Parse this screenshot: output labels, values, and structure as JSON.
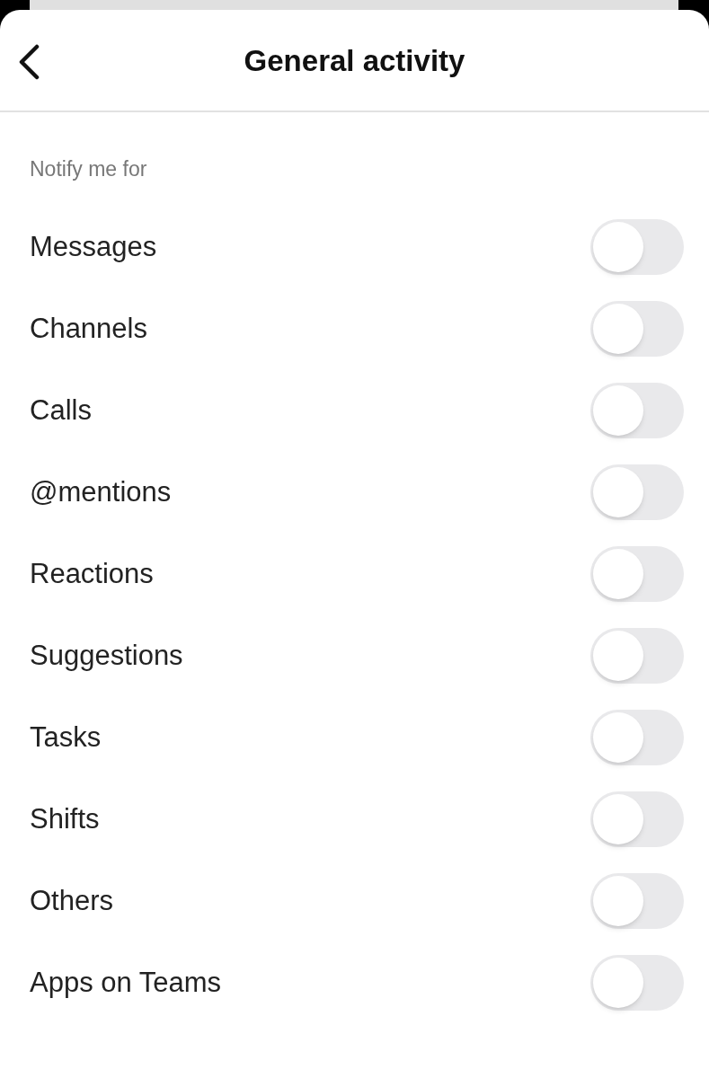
{
  "header": {
    "title": "General activity"
  },
  "section": {
    "label": "Notify me for"
  },
  "settings": [
    {
      "label": "Messages",
      "on": false
    },
    {
      "label": "Channels",
      "on": false
    },
    {
      "label": "Calls",
      "on": false
    },
    {
      "label": "@mentions",
      "on": false
    },
    {
      "label": "Reactions",
      "on": false
    },
    {
      "label": "Suggestions",
      "on": false
    },
    {
      "label": "Tasks",
      "on": false
    },
    {
      "label": "Shifts",
      "on": false
    },
    {
      "label": "Others",
      "on": false
    },
    {
      "label": "Apps on Teams",
      "on": false
    }
  ]
}
